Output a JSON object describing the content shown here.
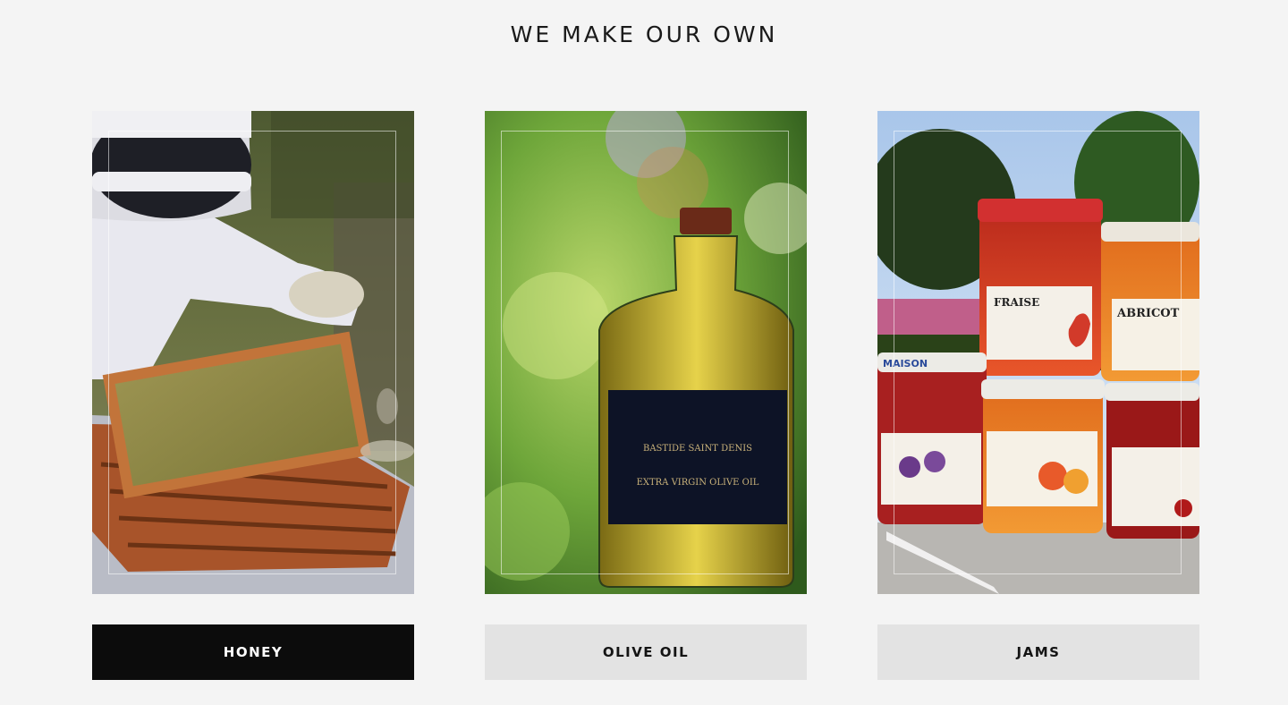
{
  "section": {
    "title": "WE MAKE OUR OWN"
  },
  "products": [
    {
      "label": "HONEY",
      "active": true,
      "image_subject": "beekeeper holding honeycomb frame"
    },
    {
      "label": "OLIVE OIL",
      "active": false,
      "image_subject": "bottle of extra virgin olive oil"
    },
    {
      "label": "JAMS",
      "active": false,
      "image_subject": "stacked jars of fruit jam"
    }
  ],
  "labels_on_images": {
    "olive_bottle_line1": "BASTIDE SAINT DENIS",
    "olive_bottle_line2": "EXTRA VIRGIN OLIVE OIL",
    "jar_apricot": "ABRICOT",
    "jar_strawberry": "FRAISE",
    "jar_brand": "MAISON"
  },
  "colors": {
    "background": "#f4f4f4",
    "active_button": "#0c0c0c",
    "inactive_button": "#e3e3e3",
    "text_dark": "#1a1a1a"
  }
}
